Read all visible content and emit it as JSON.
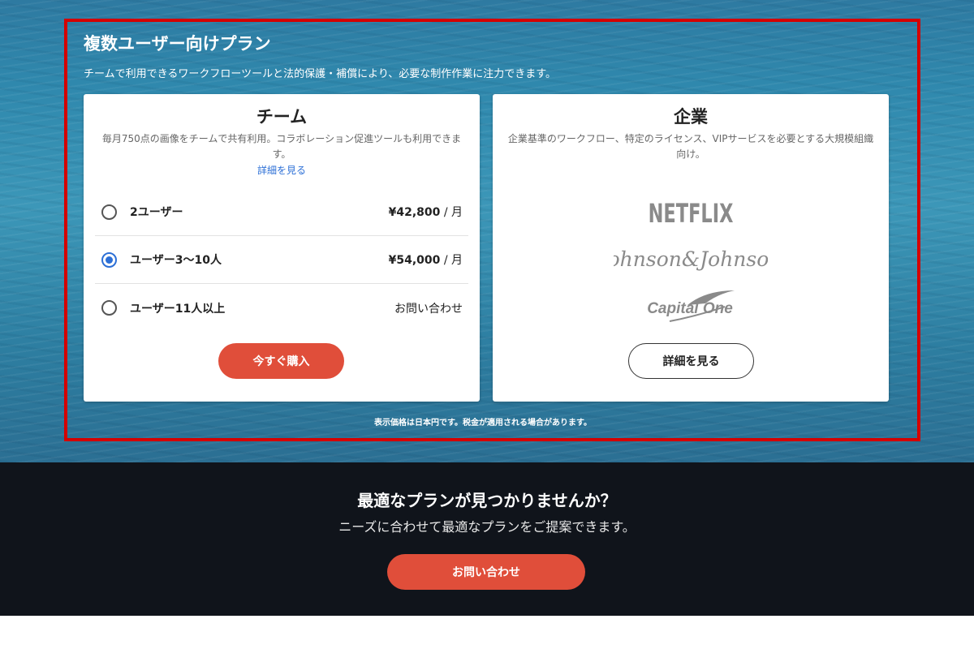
{
  "section": {
    "title": "複数ユーザー向けプラン",
    "subtitle": "チームで利用できるワークフローツールと法的保護・補償により、必要な制作作業に注力できます。",
    "note": "表示価格は日本円です。税金が適用される場合があります。"
  },
  "team": {
    "title": "チーム",
    "description": "毎月750点の画像をチームで共有利用。コラボレーション促進ツールも利用できます。",
    "link": "詳細を見る",
    "options": [
      {
        "label": "2ユーザー",
        "price": "¥42,800",
        "unit": " / 月",
        "selected": false
      },
      {
        "label": "ユーザー3〜10人",
        "price": "¥54,000",
        "unit": " / 月",
        "selected": true
      },
      {
        "label": "ユーザー11人以上",
        "price": "お問い合わせ",
        "unit": "",
        "selected": false
      }
    ],
    "buy_button": "今すぐ購入"
  },
  "enterprise": {
    "title": "企業",
    "description": "企業基準のワークフロー、特定のライセンス、VIPサービスを必要とする大規模組織向け。",
    "logos": {
      "netflix": "NETFLIX",
      "jj": "Johnson&Johnson",
      "capital_one": "Capital One"
    },
    "details_button": "詳細を見る"
  },
  "footer": {
    "title": "最適なプランが見つかりませんか？",
    "subtitle": "ニーズに合わせて最適なプランをご提案できます。",
    "contact_button": "お問い合わせ"
  },
  "colors": {
    "accent": "#e04e3a",
    "radio_selected": "#2c6fd6",
    "highlight_border": "#d40000",
    "dark_bg": "#10141b"
  }
}
